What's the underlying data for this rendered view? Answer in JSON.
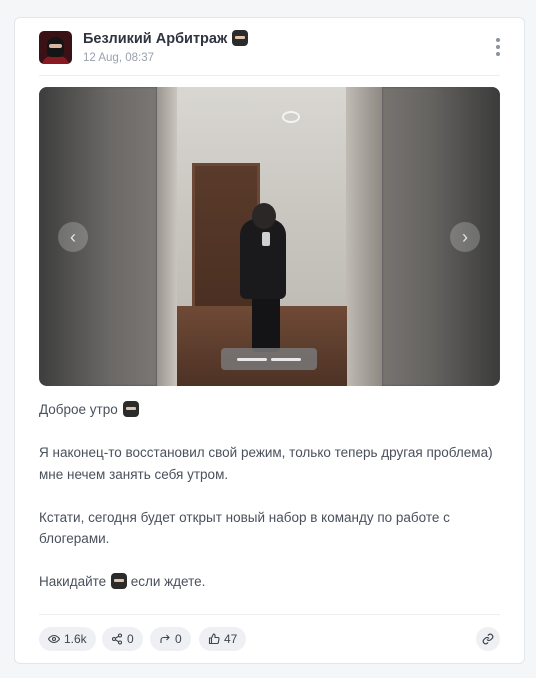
{
  "post": {
    "author": "Безликий Арбитраж",
    "date": "12 Aug, 08:37",
    "text": {
      "line1": "Доброе утро",
      "para2": "Я наконец-то восстановил свой режим, только теперь другая проблема) мне нечем занять себя утром.",
      "para3": "Кстати, сегодня будет открыт новый набор в команду по работе с блогерами.",
      "para4_before": "Накидайте",
      "para4_after": "если ждете."
    }
  },
  "media": {
    "prev_icon": "chevron-left-icon",
    "next_icon": "chevron-right-icon",
    "slides": 2,
    "active_slide": 1
  },
  "stats": {
    "views": "1.6k",
    "shares": "0",
    "forwards": "0",
    "likes": "47"
  },
  "icons": {
    "more": "more-vertical-icon",
    "views": "eye-icon",
    "shares": "share-icon",
    "forwards": "forward-icon",
    "likes": "thumbs-up-icon",
    "link": "link-icon",
    "author_badge": "ninja-emoji"
  }
}
